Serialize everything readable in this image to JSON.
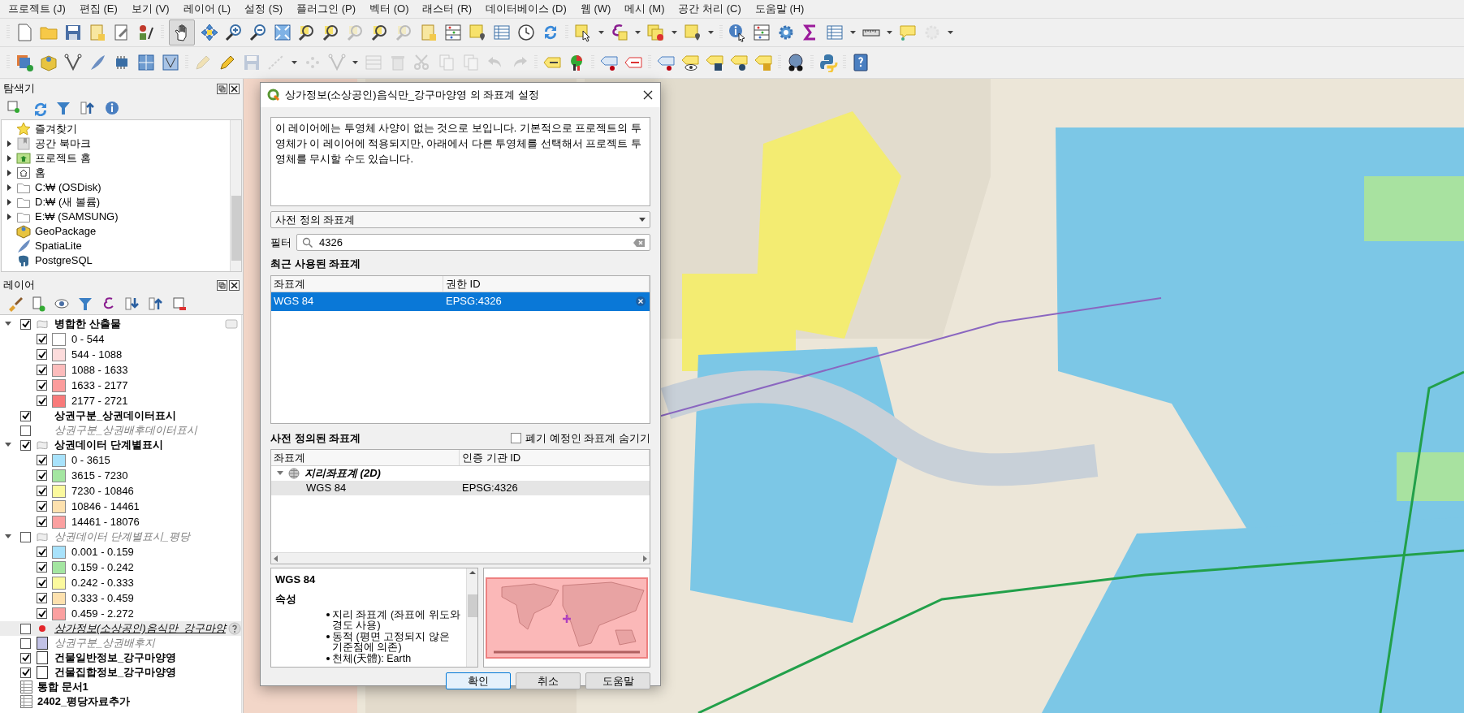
{
  "menu_bar": [
    {
      "label": "프로젝트 (J)"
    },
    {
      "label": "편집 (E)"
    },
    {
      "label": "보기 (V)"
    },
    {
      "label": "레이어 (L)"
    },
    {
      "label": "설정 (S)"
    },
    {
      "label": "플러그인 (P)"
    },
    {
      "label": "벡터 (O)"
    },
    {
      "label": "래스터 (R)"
    },
    {
      "label": "데이터베이스 (D)"
    },
    {
      "label": "웹 (W)"
    },
    {
      "label": "메시 (M)"
    },
    {
      "label": "공간 처리 (C)"
    },
    {
      "label": "도움말 (H)"
    }
  ],
  "browser_panel": {
    "title": "탐색기",
    "items": [
      {
        "label": "즐겨찾기",
        "kind": "favorites",
        "expandable": false
      },
      {
        "label": "공간 북마크",
        "kind": "bookmarks",
        "expandable": true
      },
      {
        "label": "프로젝트 홈",
        "kind": "project_home",
        "expandable": true
      },
      {
        "label": "홈",
        "kind": "home",
        "expandable": true
      },
      {
        "label": "C:₩ (OSDisk)",
        "kind": "drive",
        "expandable": true
      },
      {
        "label": "D:₩ (새 볼륨)",
        "kind": "drive",
        "expandable": true
      },
      {
        "label": "E:₩ (SAMSUNG)",
        "kind": "drive",
        "expandable": true
      },
      {
        "label": "GeoPackage",
        "kind": "geopackage",
        "expandable": false
      },
      {
        "label": "SpatiaLite",
        "kind": "spatialite",
        "expandable": false
      },
      {
        "label": "PostgreSQL",
        "kind": "postgres",
        "expandable": false
      }
    ]
  },
  "layers_panel": {
    "title": "레이어",
    "layers": [
      {
        "name": "병합한 산출물",
        "kind": "group",
        "checked": true,
        "expanded": true,
        "selected": false,
        "children": [
          {
            "label": "0 - 544",
            "checked": true,
            "color": "#ffffff"
          },
          {
            "label": "544 - 1088",
            "checked": true,
            "color": "#fddcdc"
          },
          {
            "label": "1088 - 1633",
            "checked": true,
            "color": "#fcbcbc"
          },
          {
            "label": "1633 - 2177",
            "checked": true,
            "color": "#fb9c9c"
          },
          {
            "label": "2177 - 2721",
            "checked": true,
            "color": "#f87a7a"
          }
        ]
      },
      {
        "name": "상권구분_상권데이터표시",
        "kind": "plain",
        "checked": true,
        "selected": false
      },
      {
        "name": "상권구분_상권배후데이터표시",
        "kind": "plain",
        "checked": false,
        "selected": false
      },
      {
        "name": "상권데이터 단계별표시",
        "kind": "group",
        "checked": true,
        "expanded": true,
        "selected": false,
        "children": [
          {
            "label": "0 - 3615",
            "checked": true,
            "color": "#a8e2fb"
          },
          {
            "label": "3615 - 7230",
            "checked": true,
            "color": "#a4e6a1"
          },
          {
            "label": "7230 - 10846",
            "checked": true,
            "color": "#fbf99e"
          },
          {
            "label": "10846 - 14461",
            "checked": true,
            "color": "#fde1ae"
          },
          {
            "label": "14461 - 18076",
            "checked": true,
            "color": "#fba0a0"
          }
        ]
      },
      {
        "name": "상권데이터 단계별표시_평당",
        "kind": "group",
        "checked": false,
        "expanded": true,
        "selected": false,
        "children": [
          {
            "label": "0.001 - 0.159",
            "checked": true,
            "color": "#a8e2fb"
          },
          {
            "label": "0.159 - 0.242",
            "checked": true,
            "color": "#a4e6a1"
          },
          {
            "label": "0.242 - 0.333",
            "checked": true,
            "color": "#fbf99e"
          },
          {
            "label": "0.333 - 0.459",
            "checked": true,
            "color": "#fde1ae"
          },
          {
            "label": "0.459 - 2.272",
            "checked": true,
            "color": "#fba0a0"
          }
        ]
      },
      {
        "name": "상가정보(소상공인)음식만_강구마양",
        "kind": "point",
        "checked": false,
        "selected": true,
        "color": "#e3262b"
      },
      {
        "name": "상권구분_상권배후지",
        "kind": "polygon",
        "checked": false,
        "selected": false,
        "color": "#c2c2e6"
      },
      {
        "name": "건물일반정보_강구마양영",
        "kind": "polygon",
        "checked": true,
        "selected": false,
        "color": "#ffffff"
      },
      {
        "name": "건물집합정보_강구마양영",
        "kind": "polygon",
        "checked": true,
        "selected": false,
        "color": "#ffffff"
      },
      {
        "name": "통합 문서1",
        "kind": "table",
        "selected": false
      },
      {
        "name": "2402_평당자료추가",
        "kind": "table",
        "selected": false
      }
    ]
  },
  "dialog": {
    "title": "상가정보(소상공인)음식만_강구마양영 의 좌표계 설정",
    "message": "이 레이어에는 투영체 사양이 없는 것으로 보입니다. 기본적으로 프로젝트의 투영체가 이 레이어에 적용되지만, 아래에서 다른 투영체를 선택해서 프로젝트 투영체를 무시할 수도 있습니다.",
    "crs_type": "사전 정의 좌표계",
    "filter": {
      "label": "필터",
      "value": "4326"
    },
    "recent": {
      "title": "최근 사용된 좌표계",
      "columns": [
        "좌표계",
        "권한 ID"
      ],
      "rows": [
        {
          "name": "WGS 84",
          "id": "EPSG:4326",
          "selected": true
        }
      ]
    },
    "predefined": {
      "title": "사전 정의된 좌표계",
      "hide_deprecated": {
        "label": "폐기 예정인 좌표계 숨기기",
        "checked": false
      },
      "columns": [
        "좌표계",
        "인증 기관 ID"
      ],
      "groups": [
        {
          "label": "지리좌표계 (2D)",
          "expanded": true,
          "children": [
            {
              "name": "WGS 84",
              "id": "EPSG:4326",
              "selected": true
            }
          ]
        }
      ]
    },
    "details": {
      "title": "WGS 84",
      "section": "속성",
      "bullets": [
        "지리 좌표계 (좌표에 위도와 경도 사용)",
        "동적 (평면 고정되지 않은 기준점에 의존)",
        "천체(天體): Earth"
      ]
    },
    "buttons": [
      {
        "label": "확인",
        "default": true
      },
      {
        "label": "취소",
        "default": false
      },
      {
        "label": "도움말",
        "default": false
      }
    ]
  }
}
